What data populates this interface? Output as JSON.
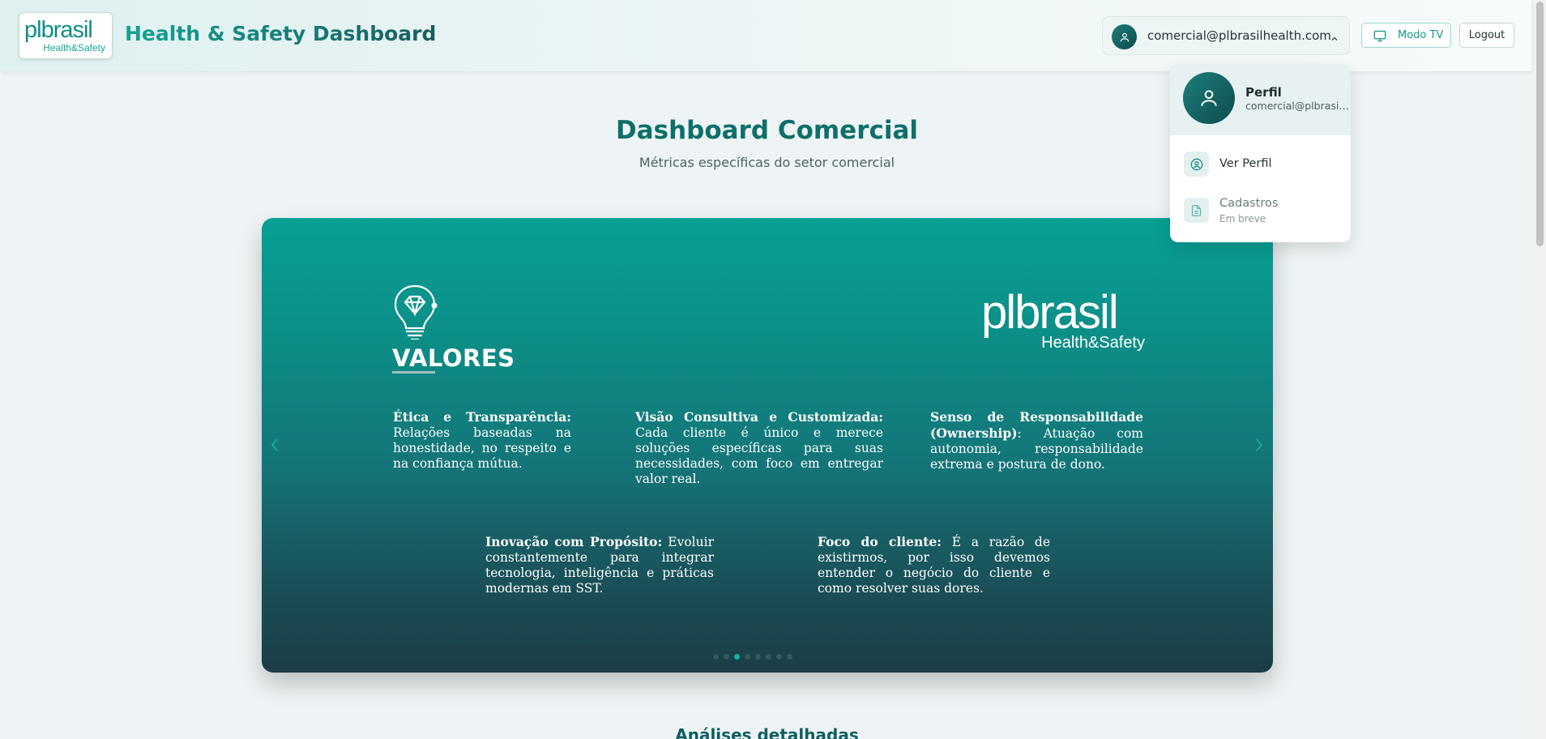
{
  "header": {
    "logo_main": "plbrasil",
    "logo_sub": "Health&Safety",
    "title": "Health & Safety Dashboard",
    "user_email": "comercial@plbrasilhealth.com",
    "tv_label": "Modo TV",
    "logout_label": "Logout"
  },
  "page": {
    "title": "Dashboard Comercial",
    "subtitle": "Métricas específicas do setor comercial",
    "next_section": "Análises detalhadas"
  },
  "carousel": {
    "heading": "VALORES",
    "brand_main": "plbrasil",
    "brand_sub": "Health&Safety",
    "values": [
      {
        "title": "Ética e Transparência:",
        "text": "Relações baseadas na honestidade, no respeito e na confiança mútua."
      },
      {
        "title": "Visão Consultiva e Customizada:",
        "text": "Cada cliente é único e merece soluções específicas para suas necessidades, com foco em entregar valor real."
      },
      {
        "title": "Senso de Responsabilidade (Ownership)",
        "text": ": Atuação com autonomia, responsabilidade extrema e postura de dono."
      },
      {
        "title": "Inovação com Propósito:",
        "text": "Evoluir constantemente para integrar tecnologia, inteligência e práticas modernas em SST."
      },
      {
        "title": "Foco do cliente:",
        "text": "É a razão de existirmos, por isso devemos entender o negócio do cliente e como resolver suas dores."
      }
    ],
    "slide_count": 8,
    "active_slide": 1
  },
  "dropdown": {
    "name": "Perfil",
    "email": "comercial@plbrasilhealth.com",
    "items": [
      {
        "label": "Ver Perfil",
        "icon": "user-circle-icon"
      },
      {
        "label": "Cadastros",
        "sublabel": "Em breve",
        "icon": "document-icon"
      }
    ]
  },
  "colors": {
    "brand_teal": "#0f8f86",
    "title_teal": "#0e6f6b",
    "accent": "#12b3a6"
  }
}
